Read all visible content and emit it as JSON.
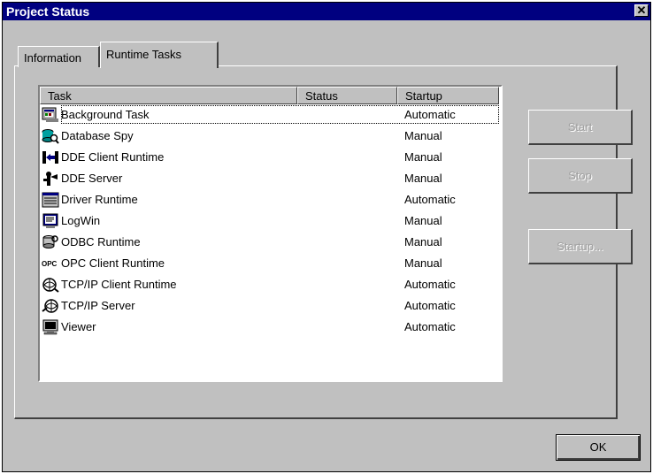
{
  "window": {
    "title": "Project Status",
    "close_label": "✕"
  },
  "tabs": [
    {
      "label": "Information"
    },
    {
      "label": "Runtime Tasks"
    }
  ],
  "list": {
    "columns": [
      "Task",
      "Status",
      "Startup"
    ],
    "rows": [
      {
        "task": "Background Task",
        "status": "",
        "startup": "Automatic",
        "icon": "background-task-icon",
        "selected": true
      },
      {
        "task": "Database Spy",
        "status": "",
        "startup": "Manual",
        "icon": "database-spy-icon"
      },
      {
        "task": "DDE Client Runtime",
        "status": "",
        "startup": "Manual",
        "icon": "dde-client-icon"
      },
      {
        "task": "DDE Server",
        "status": "",
        "startup": "Manual",
        "icon": "dde-server-icon"
      },
      {
        "task": "Driver Runtime",
        "status": "",
        "startup": "Automatic",
        "icon": "driver-runtime-icon"
      },
      {
        "task": "LogWin",
        "status": "",
        "startup": "Manual",
        "icon": "logwin-icon"
      },
      {
        "task": "ODBC Runtime",
        "status": "",
        "startup": "Manual",
        "icon": "odbc-icon"
      },
      {
        "task": "OPC Client Runtime",
        "status": "",
        "startup": "Manual",
        "icon": "opc-icon"
      },
      {
        "task": "TCP/IP Client Runtime",
        "status": "",
        "startup": "Automatic",
        "icon": "tcpip-client-icon"
      },
      {
        "task": "TCP/IP Server",
        "status": "",
        "startup": "Automatic",
        "icon": "tcpip-server-icon"
      },
      {
        "task": "Viewer",
        "status": "",
        "startup": "Automatic",
        "icon": "viewer-icon"
      }
    ]
  },
  "buttons": {
    "start": "Start",
    "stop": "Stop",
    "startup": "Startup...",
    "ok": "OK"
  }
}
